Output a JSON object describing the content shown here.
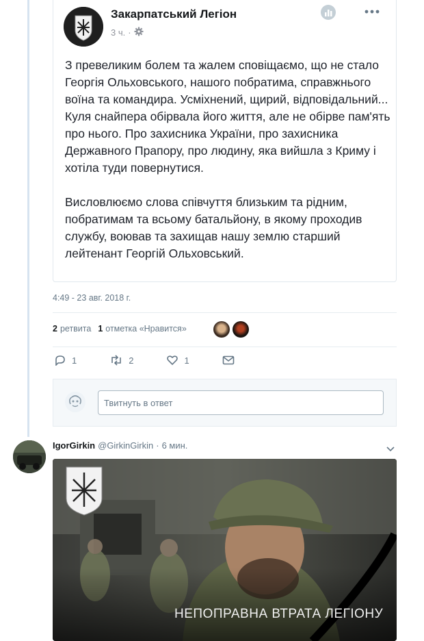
{
  "embedded_post": {
    "page_name": "Закарпатський Легіон",
    "time": "3 ч.",
    "paragraphs": [
      "З превеликим болем та жалем сповіщаємо, що не стало Георгія Ольховського,  нашого побратима, справжнього воїна та командира. Усміхнений, щирий, відповідальний... Куля снайпера обірвала його життя, але не обірве пам'ять про нього. Про захисника України, про захисника Державного Прапору, про людину, яка вийшла з Криму і хотіла туди повернутися.",
      "Висловлюємо слова співчуття близьким та рідним, побратимам та всьому батальйону, в якому проходив службу, воював та захищав нашу землю старший лейтенант Георгій Ольховський."
    ]
  },
  "tweet": {
    "timestamp": "4:49 - 23 авг. 2018 г.",
    "retweets_count": "2",
    "retweets_label": "ретвита",
    "likes_count": "1",
    "likes_label": "отметка «Нравится»",
    "actions": {
      "reply_count": "1",
      "retweet_count": "2",
      "like_count": "1"
    }
  },
  "reply_box": {
    "placeholder": "Твитнуть в ответ"
  },
  "next_tweet": {
    "author_name": "IgorGirkin",
    "handle": "@GirkinGirkin",
    "separator": "·",
    "time": "6 мин.",
    "media_caption": "НЕПОПРАВНА ВТРАТА ЛЕГІОНУ"
  },
  "colors": {
    "accent": "#1da1f2",
    "secondary_text": "#657786",
    "thread_line": "#d6e3f0"
  }
}
